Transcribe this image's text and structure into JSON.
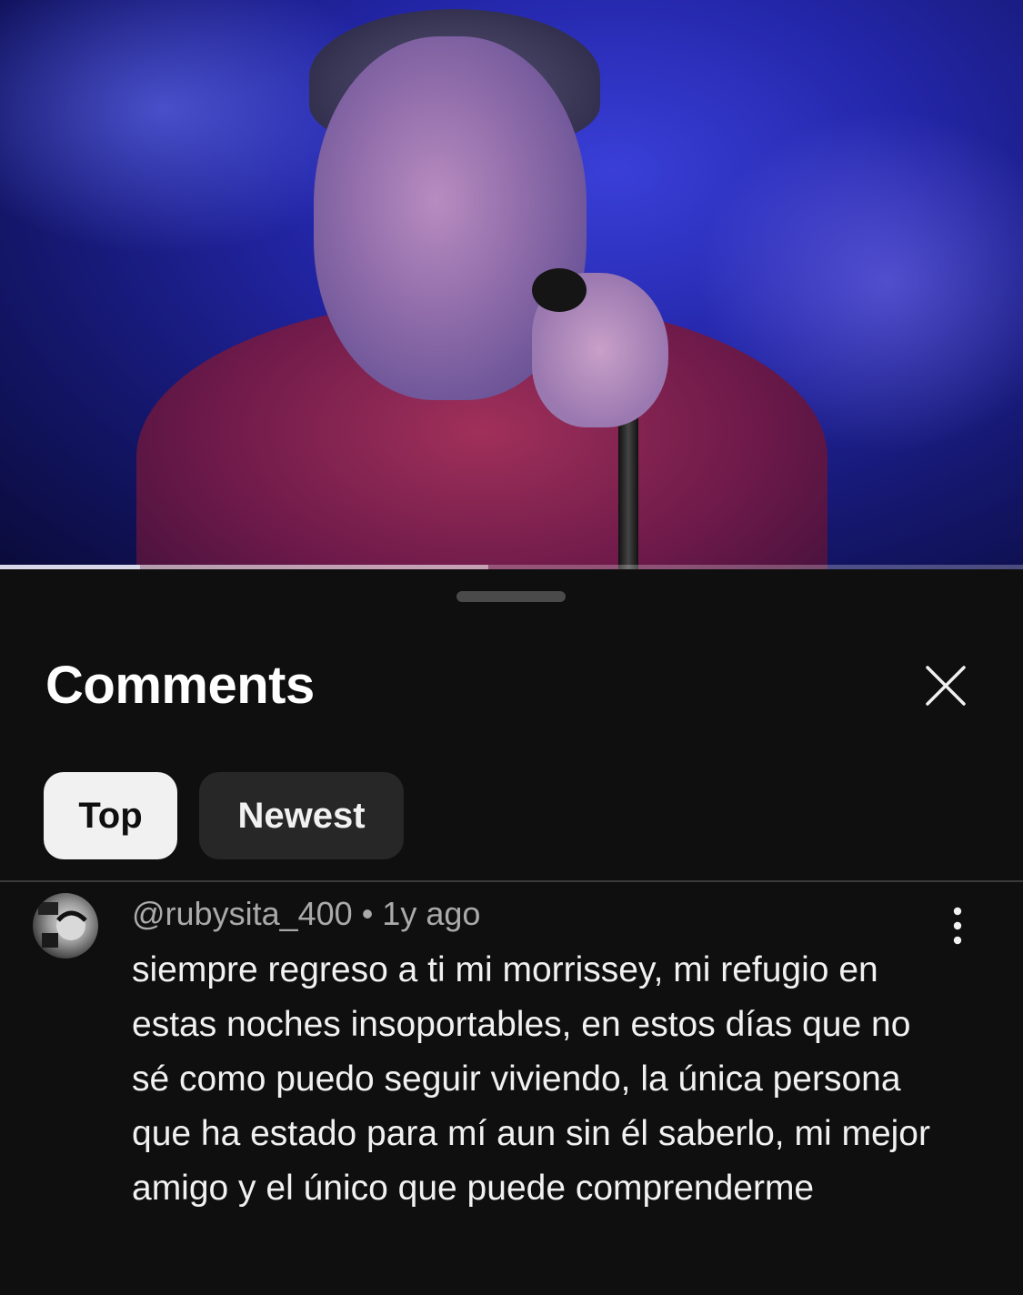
{
  "video": {
    "progress_played": 0.137,
    "progress_buffered": 0.477
  },
  "comments_panel": {
    "title": "Comments",
    "close_icon": "close-icon",
    "filters": [
      {
        "label": "Top",
        "selected": true
      },
      {
        "label": "Newest",
        "selected": false
      }
    ]
  },
  "comments": [
    {
      "author": "@rubysita_400",
      "separator": "•",
      "time": "1y ago",
      "text": "siempre regreso a ti mi morrissey, mi refugio en estas noches insoportables, en estos días que no sé como puedo seguir viviendo, la única persona que ha estado para mí aun sin él saberlo, mi mejor amigo y el único que puede comprenderme",
      "menu_icon": "more-vertical-icon"
    }
  ],
  "colors": {
    "background": "#0f0f0f",
    "chip_active_bg": "#f1f1f1",
    "chip_inactive_bg": "#272727",
    "secondary_text": "#aaaaaa"
  }
}
